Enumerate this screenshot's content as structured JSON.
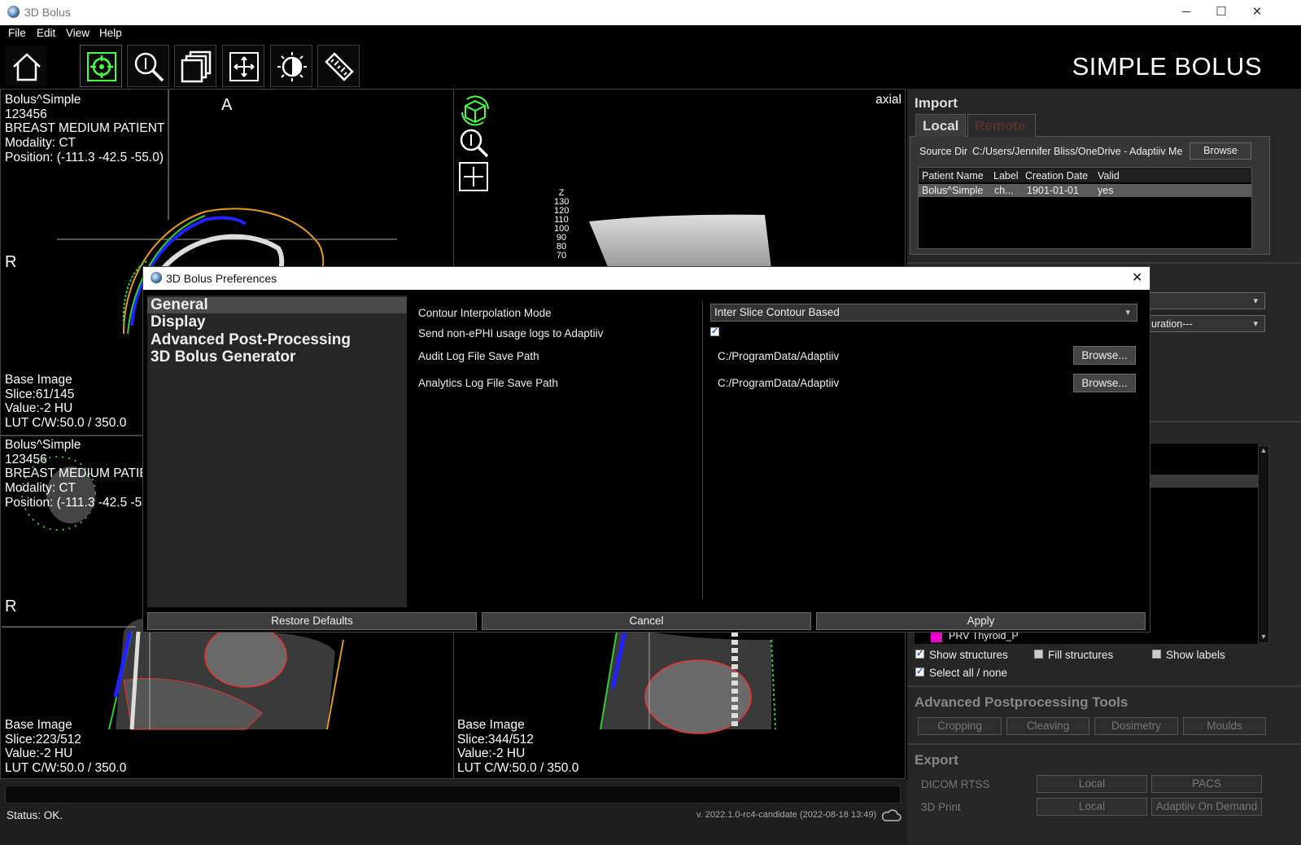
{
  "window": {
    "title": "3D Bolus"
  },
  "menu": [
    "File",
    "Edit",
    "View",
    "Help"
  ],
  "brand": "SIMPLE BOLUS",
  "toolbar_icons": [
    "home-icon",
    "crosshair-icon",
    "zoom-icon",
    "layers-icon",
    "pan-icon",
    "contrast-icon",
    "ruler-icon"
  ],
  "viewports": {
    "top_left": {
      "info": [
        "Bolus^Simple",
        "123456",
        "BREAST MEDIUM PATIENT",
        "Modality: CT",
        "Position: (-111.3 -42.5 -55.0)"
      ],
      "orient_a": "A",
      "orient_r": "R",
      "footer": [
        "Base Image",
        "Slice:61/145",
        "Value:-2 HU",
        "LUT C/W:50.0 / 350.0"
      ]
    },
    "top_right": {
      "label": "axial",
      "ticks": [
        "Z",
        "130",
        "120",
        "110",
        "100",
        "90",
        "80",
        "70"
      ]
    },
    "bottom_left": {
      "info": [
        "Bolus^Simple",
        "123456",
        "BREAST MEDIUM PATIE",
        "Modality: CT",
        "Position: (-111.3 -42.5 -5"
      ],
      "orient_r": "R",
      "footer": [
        "Base Image",
        "Slice:223/512",
        "Value:-2 HU",
        "LUT C/W:50.0 / 350.0"
      ]
    },
    "bottom_right": {
      "footer": [
        "Base Image",
        "Slice:344/512",
        "Value:-2 HU",
        "LUT C/W:50.0 / 350.0"
      ]
    }
  },
  "status": {
    "text": "Status: OK.",
    "version": "v. 2022.1.0-rc4-candidate (2022-08-18 13:49)"
  },
  "right_panel": {
    "import_title": "Import",
    "tabs": [
      "Local",
      "Remote"
    ],
    "source_dir_label": "Source Dir",
    "source_dir_value": "C:/Users/Jennifer Bliss/OneDrive - Adaptiiv Me",
    "browse": "Browse",
    "table_headers": [
      "Patient Name",
      "Label",
      "Creation Date",
      "Valid"
    ],
    "table_rows": [
      [
        "Bolus^Simple",
        "ch...",
        "1901-01-01",
        "yes"
      ]
    ],
    "dropdown2_partial": "uration---",
    "structure_partial": "PRV Thyroid_P",
    "show_structures": "Show structures",
    "fill_structures": "Fill structures",
    "show_labels": "Show labels",
    "select_all": "Select all / none",
    "adv_title": "Advanced Postprocessing Tools",
    "adv_buttons": [
      "Cropping",
      "Cleaving",
      "Dosimetry",
      "Moulds"
    ],
    "export_title": "Export",
    "export_rows": [
      {
        "label": "DICOM RTSS",
        "b1": "Local",
        "b2": "PACS"
      },
      {
        "label": "3D Print",
        "b1": "Local",
        "b2": "Adaptiiv On Demand"
      }
    ]
  },
  "dialog": {
    "title": "3D Bolus Preferences",
    "nav": [
      "General",
      "Display",
      "Advanced Post-Processing",
      "3D Bolus Generator"
    ],
    "rows": {
      "interp_label": "Contour Interpolation Mode",
      "interp_value": "Inter Slice Contour Based",
      "logs_label": "Send non-ePHI usage logs to Adaptiiv",
      "audit_label": "Audit Log File Save Path",
      "audit_value": "C:/ProgramData/Adaptiiv",
      "analytics_label": "Analytics Log File Save Path",
      "analytics_value": "C:/ProgramData/Adaptiiv",
      "browse": "Browse..."
    },
    "buttons": {
      "restore": "Restore Defaults",
      "cancel": "Cancel",
      "apply": "Apply"
    }
  }
}
